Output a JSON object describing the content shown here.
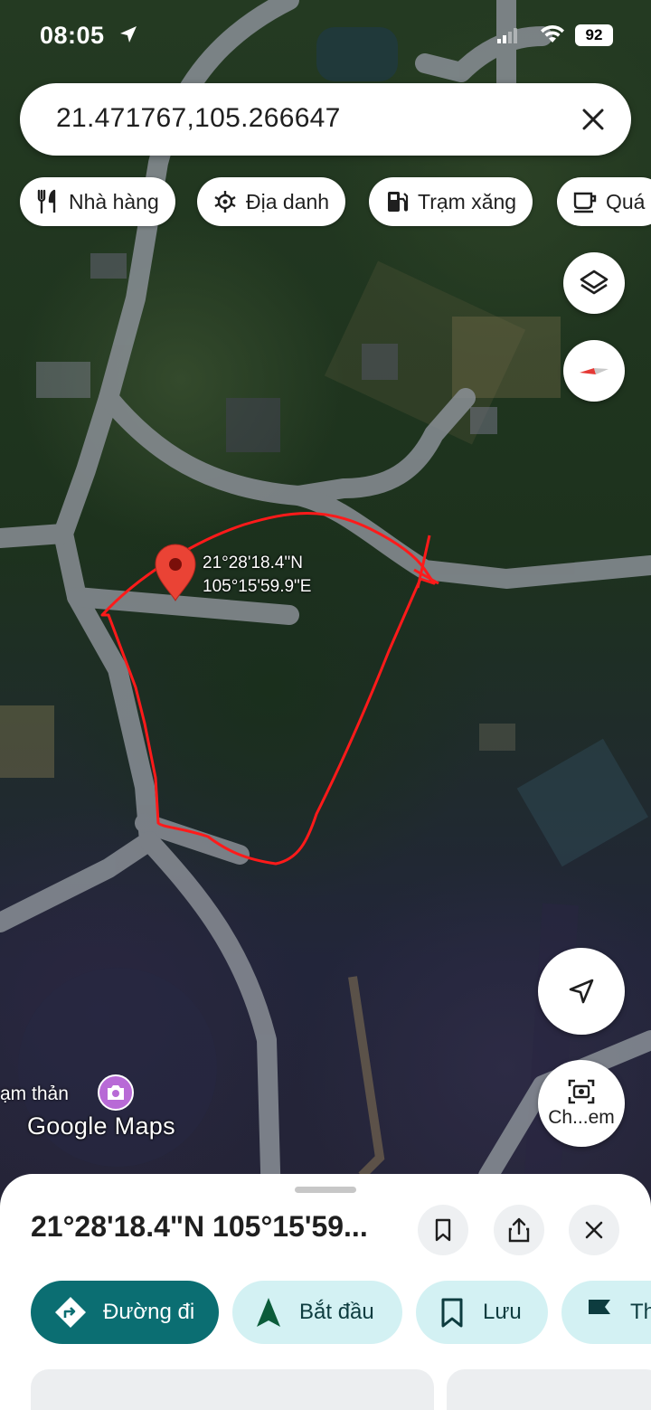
{
  "status_bar": {
    "time": "08:05",
    "battery": "92",
    "icons": [
      "location-arrow-icon",
      "signal-icon",
      "wifi-icon",
      "battery-icon"
    ]
  },
  "search": {
    "query": "21.471767,105.266647",
    "close_icon": "close-icon"
  },
  "chips": [
    {
      "label": "Nhà hàng",
      "icon": "restaurant-icon"
    },
    {
      "label": "Địa danh",
      "icon": "landmark-icon"
    },
    {
      "label": "Trạm xăng",
      "icon": "gas-station-icon"
    },
    {
      "label": "Quá",
      "icon": "coffee-icon"
    }
  ],
  "map": {
    "pin_label_line1": "21°28'18.4\"N",
    "pin_label_line2": "105°15'59.9\"E",
    "poi_label": "ạm thản",
    "logo": "Google Maps",
    "screenshot_button_label": "Ch...em",
    "colors": {
      "pin": "#ea4335",
      "drawn_outline": "#ff1a1a",
      "road": "#8a8f96"
    }
  },
  "sheet": {
    "title": "21°28'18.4\"N 105°15'59...",
    "actions": [
      {
        "label": "Đường đi",
        "icon": "directions-icon"
      },
      {
        "label": "Bắt đầu",
        "icon": "navigation-icon"
      },
      {
        "label": "Lưu",
        "icon": "bookmark-icon"
      },
      {
        "label": "Th",
        "icon": "flag-icon"
      }
    ],
    "colors": {
      "primary": "#0b6e72",
      "secondary": "#d3f1f3",
      "secondary_text": "#0d3c3f"
    }
  }
}
